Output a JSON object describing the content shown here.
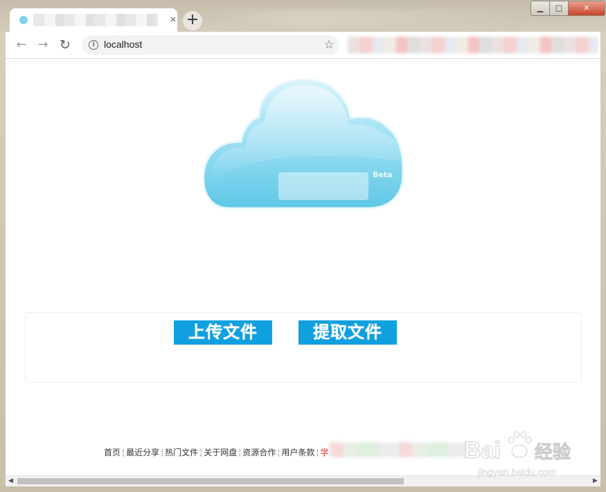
{
  "browser": {
    "tab": {
      "favicon": "cloud-favicon",
      "close_glyph": "×"
    },
    "new_tab_glyph": "+",
    "window_controls": {
      "minimize": "▁",
      "maximize": "□",
      "close": "✕"
    },
    "nav": {
      "back_glyph": "←",
      "forward_glyph": "→",
      "reload_glyph": "↻"
    },
    "address": {
      "info_glyph": "i",
      "url": "localhost",
      "star_glyph": "☆"
    }
  },
  "page": {
    "logo": {
      "badge": "Beta"
    },
    "actions": {
      "upload_label": "上传文件",
      "extract_label": "提取文件"
    },
    "footer": {
      "links": [
        "首页",
        "最近分享",
        "热门文件",
        "关于网盘",
        "资源合作",
        "用户条款"
      ],
      "partial": "学"
    }
  },
  "watermark": {
    "brand_left": "Bai",
    "brand_right": "经验",
    "url": "jingyan.baidu.com"
  },
  "scrollbar": {
    "left_glyph": "◀",
    "right_glyph": "▶"
  },
  "colors": {
    "action_button": "#10a0e0",
    "cloud_light": "#cdeffa",
    "cloud_dark": "#5ec7e6"
  }
}
